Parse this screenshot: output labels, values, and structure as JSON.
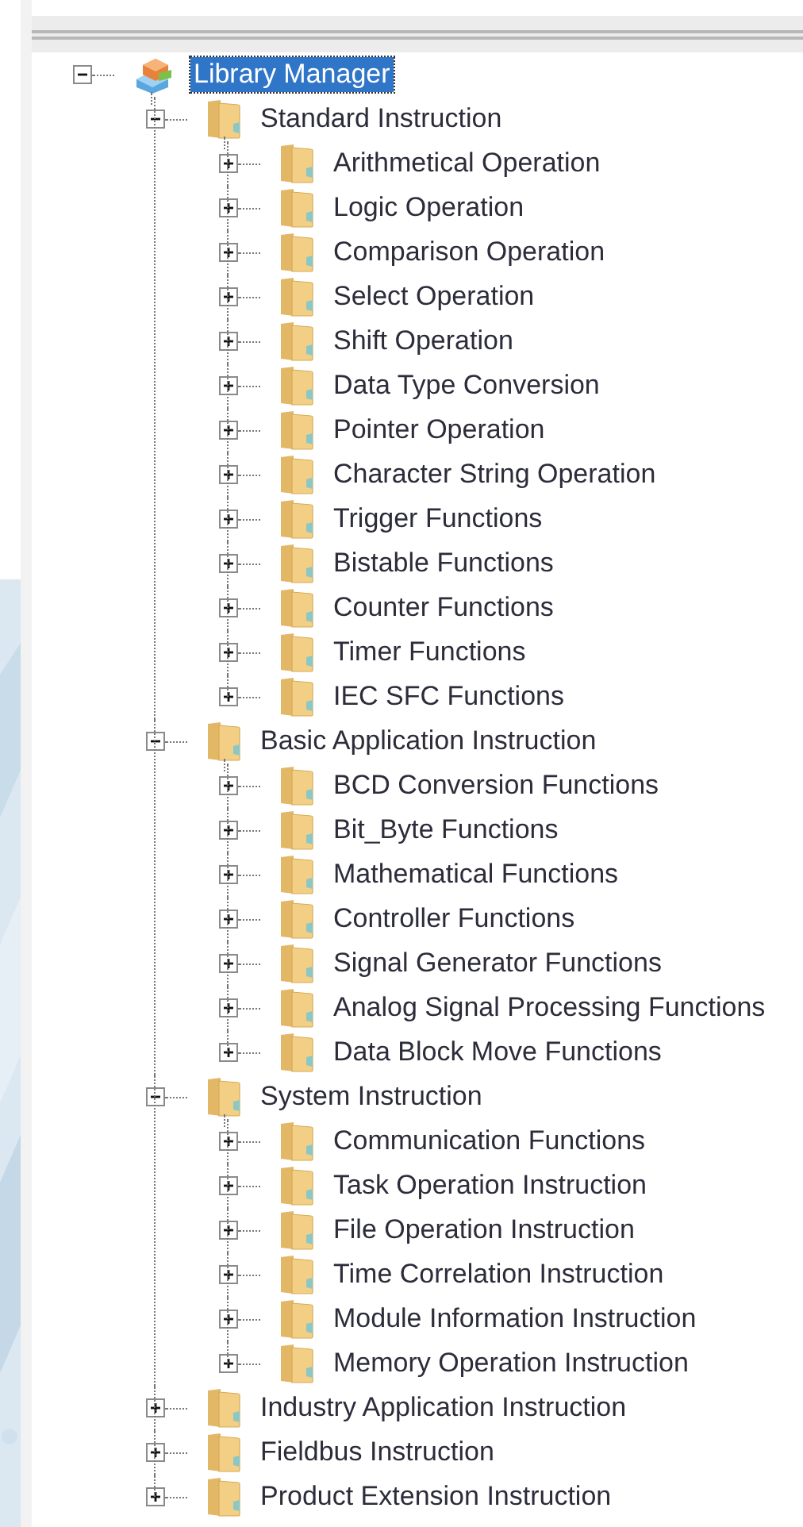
{
  "tree": {
    "items": [
      {
        "label": "Library Manager",
        "kind": "library",
        "expanded": true,
        "selected": true,
        "children": [
          {
            "label": "Standard Instruction",
            "kind": "folder",
            "expanded": true,
            "selected": false,
            "children": [
              {
                "label": "Arithmetical Operation",
                "kind": "folder",
                "expanded": false,
                "selected": false
              },
              {
                "label": "Logic Operation",
                "kind": "folder",
                "expanded": false,
                "selected": false
              },
              {
                "label": "Comparison Operation",
                "kind": "folder",
                "expanded": false,
                "selected": false
              },
              {
                "label": "Select Operation",
                "kind": "folder",
                "expanded": false,
                "selected": false
              },
              {
                "label": "Shift Operation",
                "kind": "folder",
                "expanded": false,
                "selected": false
              },
              {
                "label": "Data Type Conversion",
                "kind": "folder",
                "expanded": false,
                "selected": false
              },
              {
                "label": "Pointer Operation",
                "kind": "folder",
                "expanded": false,
                "selected": false
              },
              {
                "label": "Character String Operation",
                "kind": "folder",
                "expanded": false,
                "selected": false
              },
              {
                "label": "Trigger Functions",
                "kind": "folder",
                "expanded": false,
                "selected": false
              },
              {
                "label": "Bistable Functions",
                "kind": "folder",
                "expanded": false,
                "selected": false
              },
              {
                "label": "Counter Functions",
                "kind": "folder",
                "expanded": false,
                "selected": false
              },
              {
                "label": "Timer Functions",
                "kind": "folder",
                "expanded": false,
                "selected": false
              },
              {
                "label": "IEC SFC Functions",
                "kind": "folder",
                "expanded": false,
                "selected": false
              }
            ]
          },
          {
            "label": "Basic Application Instruction",
            "kind": "folder",
            "expanded": true,
            "selected": false,
            "children": [
              {
                "label": "BCD Conversion Functions",
                "kind": "folder",
                "expanded": false,
                "selected": false
              },
              {
                "label": "Bit_Byte Functions",
                "kind": "folder",
                "expanded": false,
                "selected": false
              },
              {
                "label": "Mathematical Functions",
                "kind": "folder",
                "expanded": false,
                "selected": false
              },
              {
                "label": "Controller Functions",
                "kind": "folder",
                "expanded": false,
                "selected": false
              },
              {
                "label": "Signal Generator Functions",
                "kind": "folder",
                "expanded": false,
                "selected": false
              },
              {
                "label": "Analog Signal Processing Functions",
                "kind": "folder",
                "expanded": false,
                "selected": false
              },
              {
                "label": "Data Block Move Functions",
                "kind": "folder",
                "expanded": false,
                "selected": false
              }
            ]
          },
          {
            "label": "System Instruction",
            "kind": "folder",
            "expanded": true,
            "selected": false,
            "children": [
              {
                "label": "Communication Functions",
                "kind": "folder",
                "expanded": false,
                "selected": false
              },
              {
                "label": "Task Operation Instruction",
                "kind": "folder",
                "expanded": false,
                "selected": false
              },
              {
                "label": "File Operation Instruction",
                "kind": "folder",
                "expanded": false,
                "selected": false
              },
              {
                "label": "Time Correlation Instruction",
                "kind": "folder",
                "expanded": false,
                "selected": false
              },
              {
                "label": "Module Information Instruction",
                "kind": "folder",
                "expanded": false,
                "selected": false
              },
              {
                "label": "Memory Operation Instruction",
                "kind": "folder",
                "expanded": false,
                "selected": false
              }
            ]
          },
          {
            "label": "Industry Application Instruction",
            "kind": "folder",
            "expanded": false,
            "selected": false
          },
          {
            "label": "Fieldbus Instruction",
            "kind": "folder",
            "expanded": false,
            "selected": false
          },
          {
            "label": "Product Extension Instruction",
            "kind": "folder",
            "expanded": false,
            "selected": false
          }
        ]
      }
    ]
  }
}
